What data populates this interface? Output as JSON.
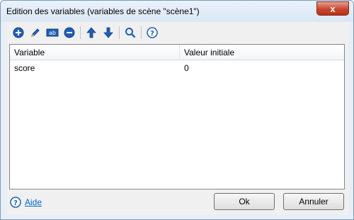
{
  "window": {
    "title": "Edition des variables (variables de scène \"scène1\")",
    "close_label": "x"
  },
  "toolbar": {
    "buttons": [
      {
        "icon": "add-icon"
      },
      {
        "icon": "edit-icon"
      },
      {
        "icon": "rename-icon",
        "icon_text": "ab"
      },
      {
        "icon": "delete-icon"
      },
      {
        "icon": "arrow-up-icon"
      },
      {
        "icon": "arrow-down-icon"
      },
      {
        "icon": "search-icon"
      },
      {
        "icon": "help-icon"
      }
    ]
  },
  "table": {
    "columns": [
      "Variable",
      "Valeur initiale"
    ],
    "rows": [
      {
        "name": "score",
        "value": "0"
      }
    ]
  },
  "footer": {
    "help_label": "Aide",
    "ok_label": "Ok",
    "cancel_label": "Annuler"
  },
  "colors": {
    "accent_blue": "#1e5fb4",
    "link_blue": "#0066cc",
    "close_red": "#c9452f"
  }
}
